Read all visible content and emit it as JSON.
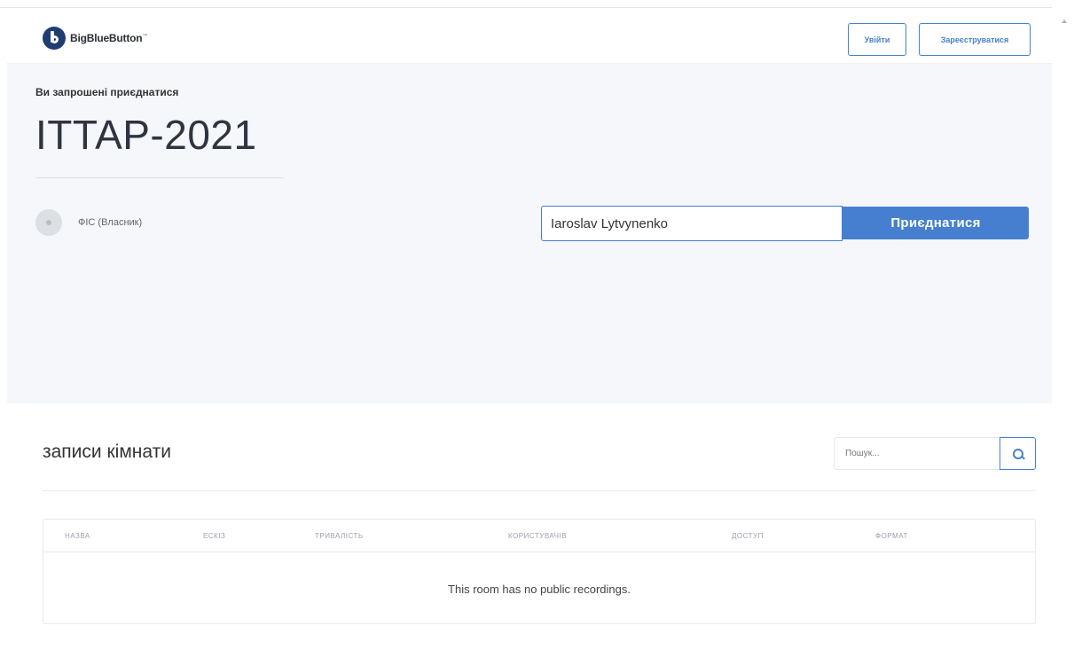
{
  "header": {
    "brand": "BigBlueButton",
    "brand_tm": "™",
    "login_label": "Увійти",
    "register_label": "Зареєструватися"
  },
  "hero": {
    "invite_text": "Ви запрошені приєднатися",
    "room_name": "ITTAP-2021",
    "owner_label": "ФІС (Власник)",
    "name_value": "Iaroslav Lytvynenko",
    "join_label": "Приєднатися"
  },
  "recordings": {
    "title": "записи кімнати",
    "search_placeholder": "Пошук...",
    "columns": [
      "НАЗВА",
      "ЕСКІЗ",
      "ТРИВАЛІСТЬ",
      "КОРИСТУВАЧІВ",
      "ДОСТУП",
      "ФОРМАТ"
    ],
    "empty_message": "This room has no public recordings."
  },
  "colors": {
    "accent": "#467fcf",
    "hero_bg": "#f5f7fb",
    "brand_dark": "#1f3d73"
  }
}
